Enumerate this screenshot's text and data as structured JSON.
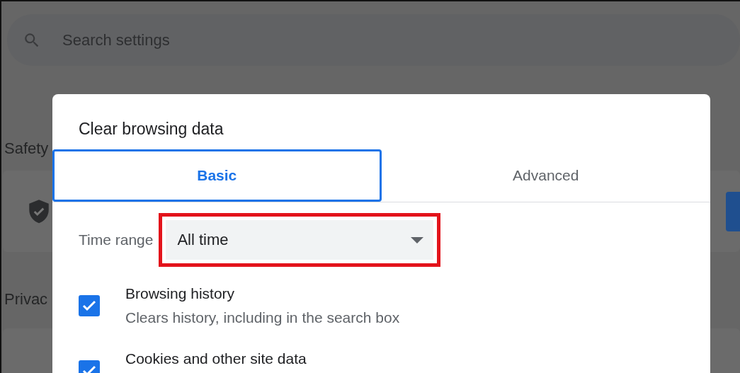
{
  "background_page": {
    "search": {
      "placeholder": "Search settings"
    },
    "sections": [
      {
        "title": "Safety"
      },
      {
        "title": "Privac"
      }
    ]
  },
  "dialog": {
    "title": "Clear browsing data",
    "tabs": [
      {
        "label": "Basic",
        "selected": true
      },
      {
        "label": "Advanced",
        "selected": false
      }
    ],
    "time_range": {
      "label": "Time range",
      "value": "All time",
      "highlighted": true
    },
    "items": [
      {
        "title": "Browsing history",
        "description": "Clears history, including in the search box",
        "checked": true
      },
      {
        "title": "Cookies and other site data",
        "checked": true
      }
    ]
  }
}
